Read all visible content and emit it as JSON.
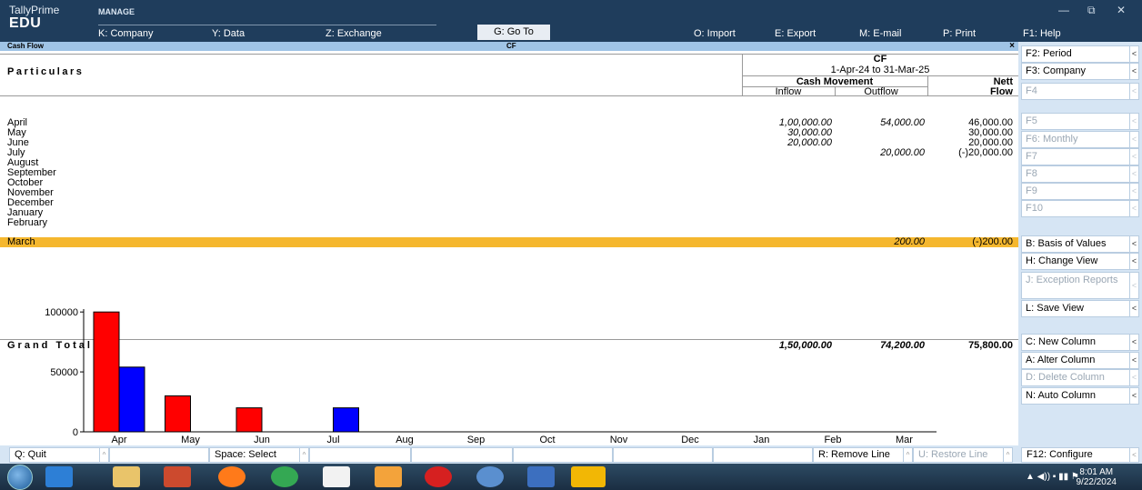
{
  "app": {
    "name": "TallyPrime",
    "edition": "EDU",
    "section": "MANAGE"
  },
  "top_menu": [
    {
      "key": "K",
      "label": "K: Company"
    },
    {
      "key": "Y",
      "label": "Y: Data"
    },
    {
      "key": "Z",
      "label": "Z: Exchange"
    },
    {
      "key": "G",
      "label": "G: Go To"
    },
    {
      "key": "O",
      "label": "O: Import"
    },
    {
      "key": "E",
      "label": "E: Export"
    },
    {
      "key": "M",
      "label": "M: E-mail"
    },
    {
      "key": "P",
      "label": "P: Print"
    },
    {
      "key": "F1",
      "label": "F1: Help"
    }
  ],
  "window_controls": {
    "minimize": "—",
    "maximize": "⧉",
    "close": "✕"
  },
  "report": {
    "title": "Cash Flow",
    "company_code": "CF",
    "close_glyph": "×",
    "particulars_label": "Particulars",
    "company_name": "CF",
    "period": "1-Apr-24 to 31-Mar-25",
    "group_header": "Cash Movement",
    "col_inflow": "Inflow",
    "col_outflow": "Outflow",
    "col_nett": "Nett",
    "col_flow": "Flow",
    "rows": [
      {
        "month": "April",
        "inflow": "1,00,000.00",
        "outflow": "54,000.00",
        "nett": "46,000.00"
      },
      {
        "month": "May",
        "inflow": "30,000.00",
        "outflow": "",
        "nett": "30,000.00"
      },
      {
        "month": "June",
        "inflow": "20,000.00",
        "outflow": "",
        "nett": "20,000.00"
      },
      {
        "month": "July",
        "inflow": "",
        "outflow": "20,000.00",
        "nett": "(-)20,000.00"
      },
      {
        "month": "August",
        "inflow": "",
        "outflow": "",
        "nett": ""
      },
      {
        "month": "September",
        "inflow": "",
        "outflow": "",
        "nett": ""
      },
      {
        "month": "October",
        "inflow": "",
        "outflow": "",
        "nett": ""
      },
      {
        "month": "November",
        "inflow": "",
        "outflow": "",
        "nett": ""
      },
      {
        "month": "December",
        "inflow": "",
        "outflow": "",
        "nett": ""
      },
      {
        "month": "January",
        "inflow": "",
        "outflow": "",
        "nett": ""
      },
      {
        "month": "February",
        "inflow": "",
        "outflow": "",
        "nett": ""
      },
      {
        "month": "March",
        "inflow": "",
        "outflow": "200.00",
        "nett": "(-)200.00"
      }
    ],
    "grand_total": {
      "label": "Grand Total",
      "inflow": "1,50,000.00",
      "outflow": "74,200.00",
      "nett": "75,800.00"
    }
  },
  "chart_data": {
    "type": "bar",
    "categories": [
      "Apr",
      "May",
      "Jun",
      "Jul",
      "Aug",
      "Sep",
      "Oct",
      "Nov",
      "Dec",
      "Jan",
      "Feb",
      "Mar"
    ],
    "series": [
      {
        "color": "#ff0000",
        "values": [
          100000,
          30000,
          20000,
          0,
          0,
          0,
          0,
          0,
          0,
          0,
          0,
          0
        ]
      },
      {
        "color": "#0000ff",
        "values": [
          54000,
          0,
          0,
          20000,
          0,
          0,
          0,
          0,
          0,
          0,
          0,
          200
        ]
      }
    ],
    "yticks": [
      0,
      50000,
      100000
    ],
    "ytick_labels": [
      "0",
      "50000",
      "100000"
    ],
    "ylim": [
      0,
      110000
    ],
    "grid": false
  },
  "right_panel": [
    {
      "label": "F2: Period",
      "enabled": true
    },
    {
      "label": "F3: Company",
      "enabled": true
    },
    {
      "label": "F4",
      "enabled": false
    },
    {
      "label": "F5",
      "enabled": false
    },
    {
      "label": "F6: Monthly",
      "enabled": false
    },
    {
      "label": "F7",
      "enabled": false
    },
    {
      "label": "F8",
      "enabled": false
    },
    {
      "label": "F9",
      "enabled": false
    },
    {
      "label": "F10",
      "enabled": false
    },
    {
      "label": "B: Basis of Values",
      "enabled": true
    },
    {
      "label": "H: Change View",
      "enabled": true
    },
    {
      "label": "J: Exception Reports",
      "enabled": false
    },
    {
      "label": "L: Save View",
      "enabled": true
    },
    {
      "label": "C: New Column",
      "enabled": true
    },
    {
      "label": "A: Alter Column",
      "enabled": true
    },
    {
      "label": "D: Delete Column",
      "enabled": false
    },
    {
      "label": "N: Auto Column",
      "enabled": true
    }
  ],
  "bottom_bar": [
    {
      "label": "Q: Quit"
    },
    {
      "label": "Space: Select"
    },
    {
      "label": "R: Remove Line"
    },
    {
      "label": "U: Restore Line"
    },
    {
      "label": "F12: Configure"
    }
  ],
  "taskbar": {
    "time": "8:01 AM",
    "date": "9/22/2024"
  },
  "colors": {
    "highlight": "#f5b72e",
    "titlebar": "#1f3d5c",
    "panel": "#d6e5f4"
  }
}
